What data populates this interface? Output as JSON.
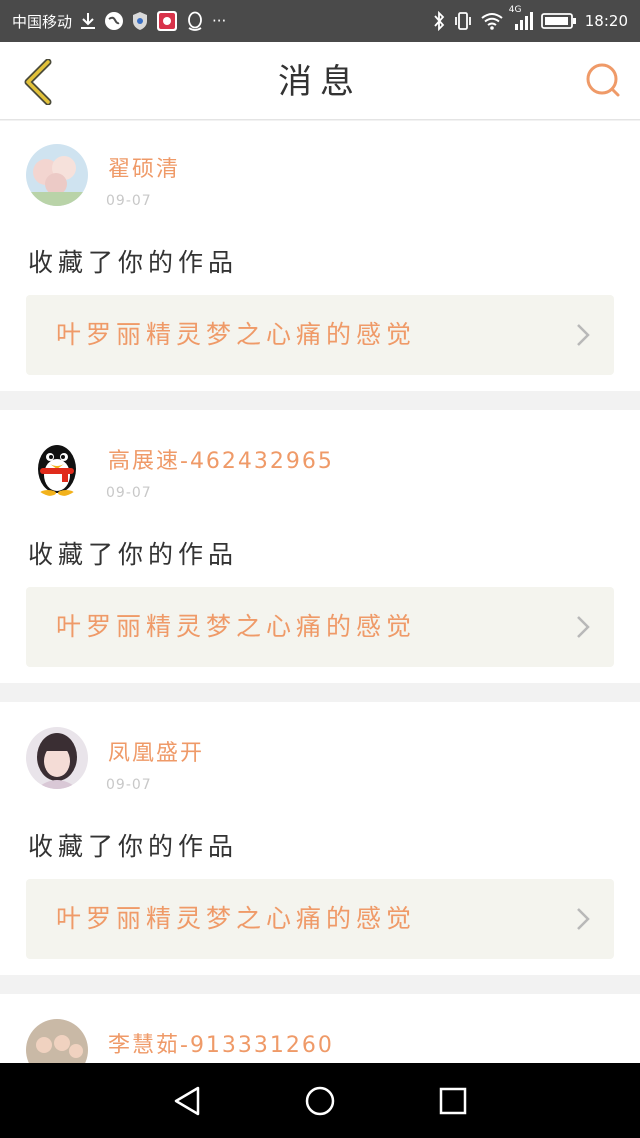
{
  "status_bar": {
    "carrier": "中国移动",
    "more": "···",
    "network": "4G",
    "time": "18:20"
  },
  "header": {
    "title": "消息"
  },
  "messages": [
    {
      "username": "翟硕清",
      "date": "09-07",
      "action": "收藏了你的作品",
      "work_title": "叶罗丽精灵梦之心痛的感觉",
      "avatar": "flower-avatar"
    },
    {
      "username": "高展速-462432965",
      "date": "09-07",
      "action": "收藏了你的作品",
      "work_title": "叶罗丽精灵梦之心痛的感觉",
      "avatar": "qq-penguin-avatar"
    },
    {
      "username": "凤凰盛开",
      "date": "09-07",
      "action": "收藏了你的作品",
      "work_title": "叶罗丽精灵梦之心痛的感觉",
      "avatar": "girl-avatar"
    },
    {
      "username": "李慧茹-913331260",
      "avatar": "group-photo-avatar"
    }
  ],
  "colors": {
    "accent": "#ef9a68",
    "work_box_bg": "#f4f4ee",
    "status_bar_bg": "#4a4a4a",
    "back_icon": "#e3c23a"
  }
}
